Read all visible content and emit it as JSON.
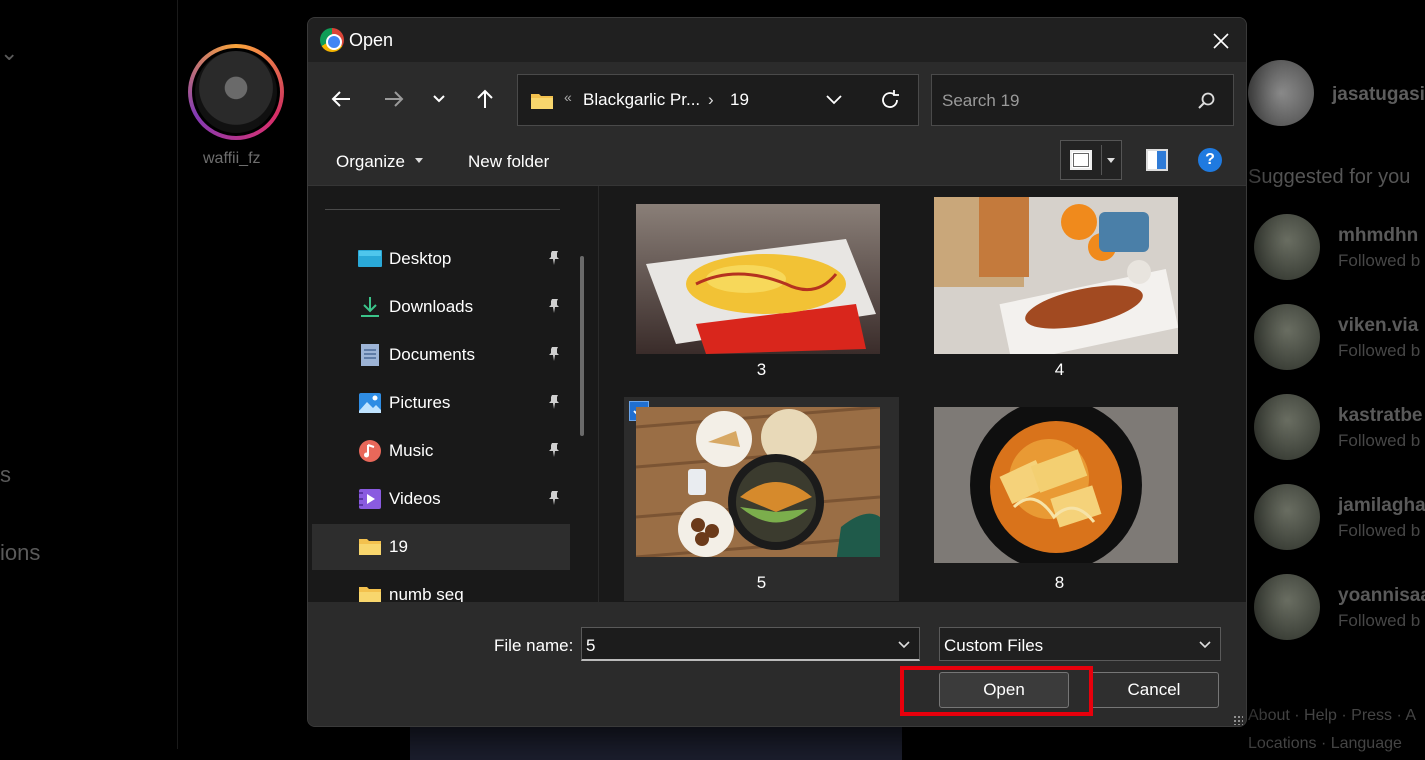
{
  "background": {
    "nav_partial": [
      "s",
      "ions"
    ],
    "story_name": "waffii_fz",
    "me_name": "jasatugasi",
    "suggested_label": "Suggested for you",
    "suggestions": [
      {
        "name": "mhmdhn",
        "sub": "Followed b"
      },
      {
        "name": "viken.via",
        "sub": "Followed b"
      },
      {
        "name": "kastratbe",
        "sub": "Followed b"
      },
      {
        "name": "jamilagha",
        "sub": "Followed b"
      },
      {
        "name": "yoannisaa",
        "sub": "Followed b"
      }
    ],
    "footer_line1": "About · Help · Press · A",
    "footer_line2": "Locations · Language"
  },
  "dialog": {
    "title": "Open",
    "address": {
      "separator": "«",
      "crumb_parent": "Blackgarlic Pr...",
      "crumb_chevron": "›",
      "crumb_current": "19"
    },
    "search": {
      "placeholder": "Search 19"
    },
    "toolbar": {
      "organize_label": "Organize",
      "new_folder_label": "New folder",
      "help_label": "?"
    },
    "sidebar": {
      "items": [
        {
          "label": "Desktop",
          "icon": "desktop-icon",
          "pinned": true
        },
        {
          "label": "Downloads",
          "icon": "download-icon",
          "pinned": true
        },
        {
          "label": "Documents",
          "icon": "document-icon",
          "pinned": true
        },
        {
          "label": "Pictures",
          "icon": "pictures-icon",
          "pinned": true
        },
        {
          "label": "Music",
          "icon": "music-icon",
          "pinned": true
        },
        {
          "label": "Videos",
          "icon": "video-icon",
          "pinned": true
        },
        {
          "label": "19",
          "icon": "folder-icon",
          "pinned": false,
          "selected": true
        },
        {
          "label": "numb seq",
          "icon": "folder-icon",
          "pinned": false
        }
      ]
    },
    "files": [
      {
        "name": "3",
        "selected": false
      },
      {
        "name": "4",
        "selected": false
      },
      {
        "name": "5",
        "selected": true
      },
      {
        "name": "8",
        "selected": false
      }
    ],
    "bottom": {
      "file_name_label": "File name:",
      "file_name_value": "5",
      "file_type_value": "Custom Files",
      "open_label": "Open",
      "cancel_label": "Cancel"
    }
  },
  "colors": {
    "accent": "#1f6fd1",
    "highlight": "#e8000c",
    "folder": "#f3c14e"
  }
}
